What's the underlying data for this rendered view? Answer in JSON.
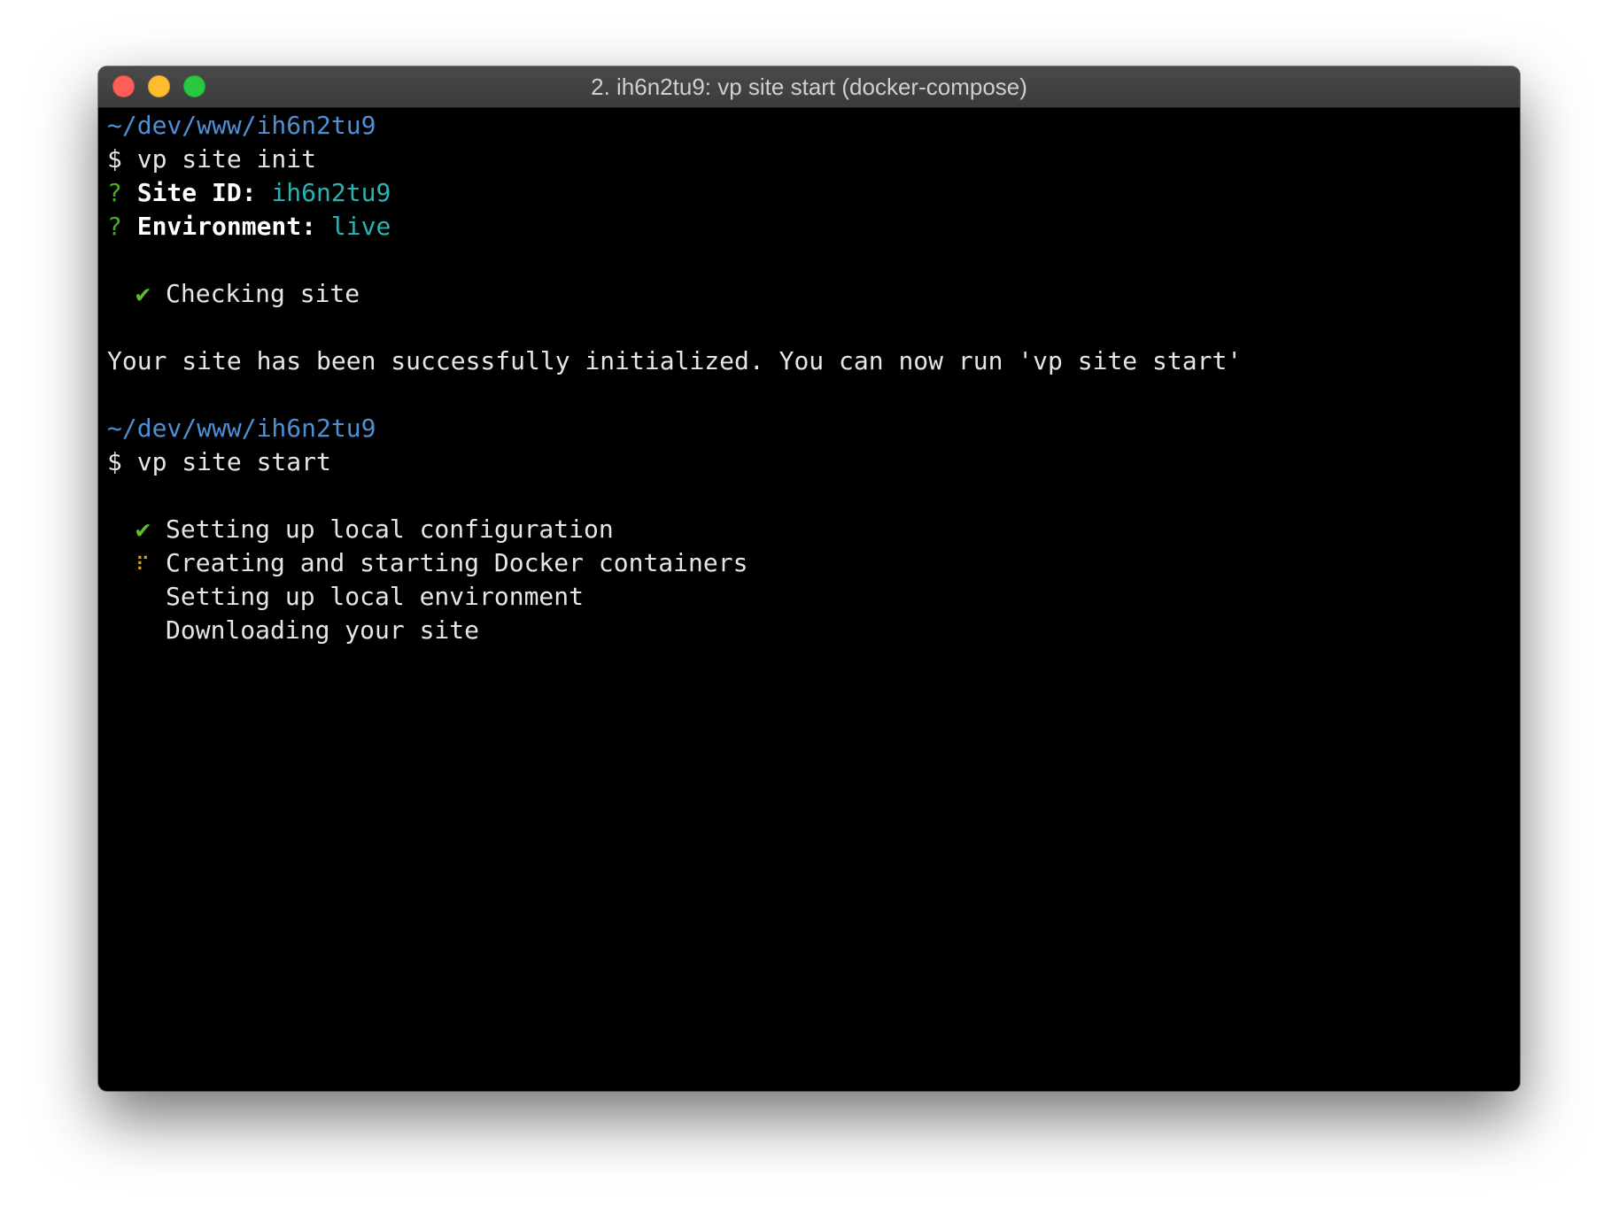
{
  "window": {
    "title": "2. ih6n2tu9: vp site start (docker-compose)"
  },
  "colors": {
    "path": "#4f8fd6",
    "prompt_question": "#4aaa2a",
    "answer": "#2bb3b3",
    "check": "#5cbf2a",
    "spinner": "#c9a227",
    "background": "#000000"
  },
  "terminal": {
    "block1": {
      "path": "~/dev/www/ih6n2tu9",
      "command": "$ vp site init",
      "site_id": {
        "marker": "?",
        "label": "Site ID:",
        "value": "ih6n2tu9"
      },
      "environment": {
        "marker": "?",
        "label": "Environment:",
        "value": "live"
      },
      "task": {
        "icon": "✔",
        "text": "Checking site"
      },
      "message": "Your site has been successfully initialized. You can now run 'vp site start'"
    },
    "block2": {
      "path": "~/dev/www/ih6n2tu9",
      "command": "$ vp site start",
      "tasks": [
        {
          "icon": "✔",
          "text": "Setting up local configuration",
          "status": "done"
        },
        {
          "icon": "⠏",
          "text": "Creating and starting Docker containers",
          "status": "running"
        },
        {
          "icon": "",
          "text": "Setting up local environment",
          "status": "pending"
        },
        {
          "icon": "",
          "text": "Downloading your site",
          "status": "pending"
        }
      ]
    }
  }
}
